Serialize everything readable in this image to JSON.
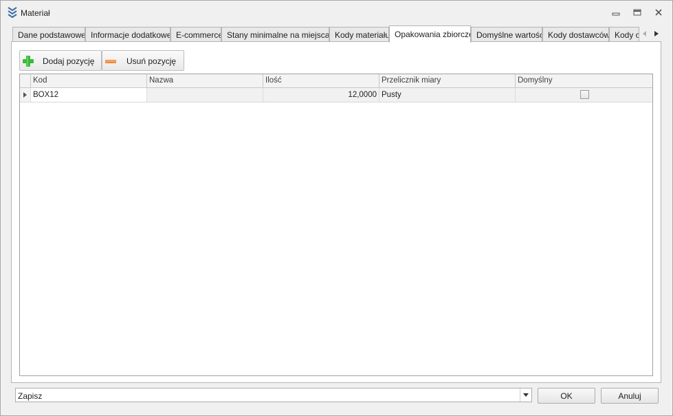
{
  "window": {
    "title": "Materiał",
    "icon": "layers-chevron-icon"
  },
  "tabs": [
    {
      "label": "Dane podstawowe",
      "active": false
    },
    {
      "label": "Informacje dodatkowe",
      "active": false
    },
    {
      "label": "E-commerce",
      "active": false
    },
    {
      "label": "Stany minimalne na miejscach",
      "active": false
    },
    {
      "label": "Kody materiału",
      "active": false
    },
    {
      "label": "Opakowania zbiorcze",
      "active": true
    },
    {
      "label": "Domyślne wartości",
      "active": false
    },
    {
      "label": "Kody dostawców",
      "active": false
    },
    {
      "label": "Kody od",
      "active": false
    }
  ],
  "toolbar": {
    "add_label": "Dodaj pozycję",
    "remove_label": "Usuń pozycję"
  },
  "grid": {
    "columns": [
      "Kod",
      "Nazwa",
      "Ilość",
      "Przelicznik miary",
      "Domyślny"
    ],
    "rows": [
      {
        "kod": "BOX12",
        "nazwa": "",
        "ilosc": "12,0000",
        "przelicznik": "Pusty",
        "domyslny": false
      }
    ]
  },
  "footer": {
    "combo_value": "Zapisz",
    "ok_label": "OK",
    "cancel_label": "Anuluj"
  },
  "colors": {
    "add_icon": "#3cb83c",
    "remove_icon": "#f08a3c",
    "title_icon": "#3a6ea5"
  }
}
